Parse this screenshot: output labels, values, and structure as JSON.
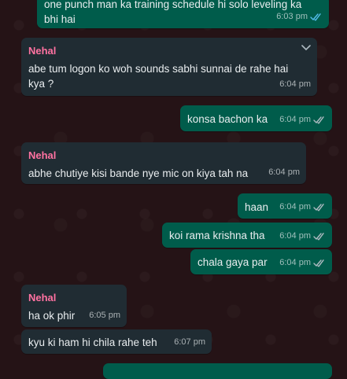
{
  "messages": [
    {
      "direction": "out",
      "lines": [
        "one punch man ka training schedule hi solo leveling ka",
        "bhi hai"
      ],
      "time": "6:03 pm",
      "status": "read"
    },
    {
      "direction": "in",
      "sender": "Nehal",
      "lines": [
        "abe tum logon ko woh sounds sabhi sunnai de rahe hai",
        "kya ?"
      ],
      "time": "6:04 pm"
    },
    {
      "direction": "out",
      "lines": [
        "konsa bachon ka"
      ],
      "time": "6:04 pm",
      "status": "read"
    },
    {
      "direction": "in",
      "sender": "Nehal",
      "lines": [
        "abhe chutiye kisi bande nye mic on kiya tah na"
      ],
      "time": "6:04 pm"
    },
    {
      "direction": "out",
      "lines": [
        "haan"
      ],
      "time": "6:04 pm",
      "status": "read"
    },
    {
      "direction": "out",
      "lines": [
        "koi rama krishna tha"
      ],
      "time": "6:04 pm",
      "status": "read"
    },
    {
      "direction": "out",
      "lines": [
        "chala gaya par"
      ],
      "time": "6:04 pm",
      "status": "read"
    },
    {
      "direction": "in",
      "sender": "Nehal",
      "lines": [
        "ha ok phir"
      ],
      "time": "6:05 pm"
    },
    {
      "direction": "in",
      "lines": [
        "kyu ki ham hi chila rahe teh"
      ],
      "time": "6:07 pm"
    }
  ],
  "colors": {
    "incoming_bubble": "#202c33",
    "outgoing_bubble": "#005c4b",
    "sender_name": "#ff72a1",
    "read_ticks": "#53bdeb",
    "background": "#251316"
  },
  "icons": [
    "chevron-down-icon",
    "double-check-icon"
  ]
}
